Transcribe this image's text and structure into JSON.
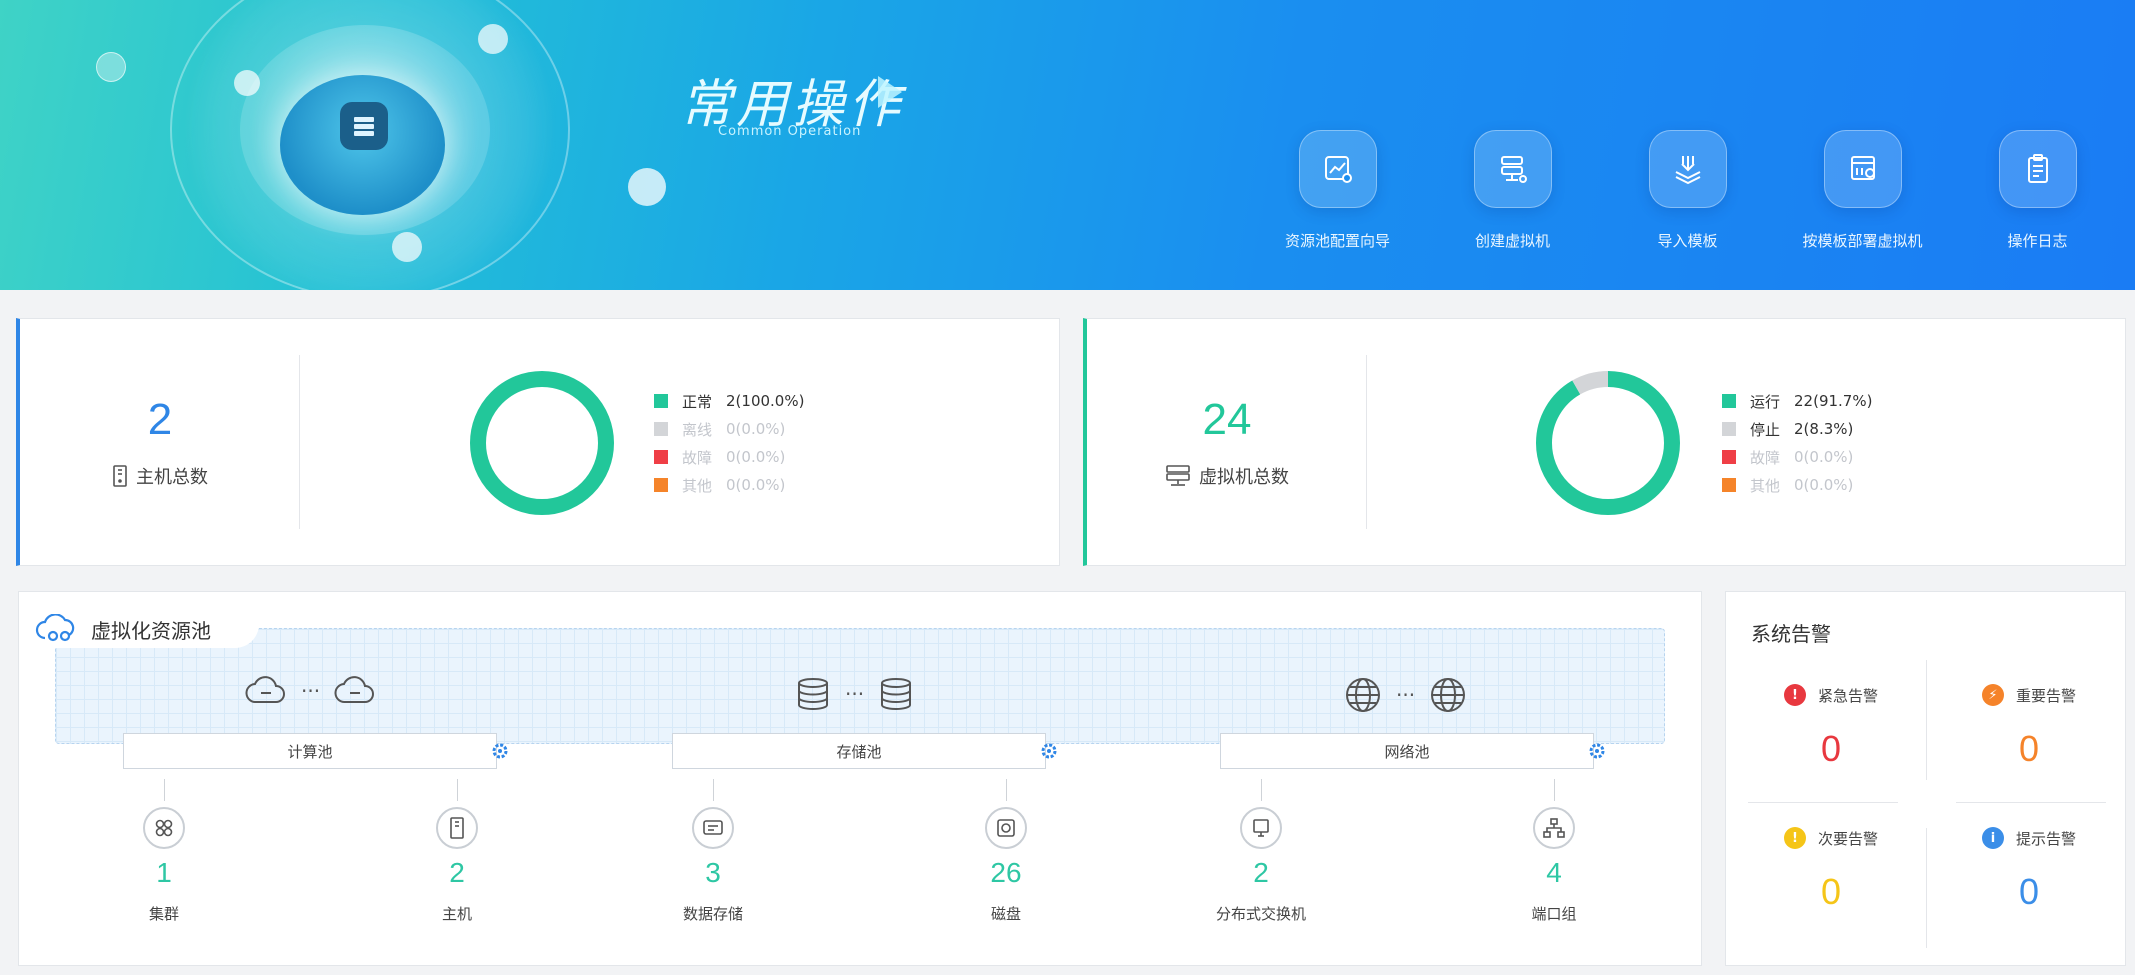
{
  "banner": {
    "title": "常用操作",
    "subtitle": "Common Operation",
    "operations": [
      {
        "label": "资源池配置向导",
        "icon": "chart-config-icon"
      },
      {
        "label": "创建虚拟机",
        "icon": "server-add-icon"
      },
      {
        "label": "导入模板",
        "icon": "import-icon"
      },
      {
        "label": "按模板部署虚拟机",
        "icon": "template-deploy-icon"
      },
      {
        "label": "操作日志",
        "icon": "clipboard-icon"
      }
    ]
  },
  "hosts": {
    "total": "2",
    "label": "主机总数",
    "legend": [
      {
        "name": "正常",
        "value": "2(100.0%)",
        "color": "#22c79a",
        "dim": false
      },
      {
        "name": "离线",
        "value": "0(0.0%)",
        "color": "#d3d5d8",
        "dim": true
      },
      {
        "name": "故障",
        "value": "0(0.0%)",
        "color": "#ef3e46",
        "dim": true
      },
      {
        "name": "其他",
        "value": "0(0.0%)",
        "color": "#f5842a",
        "dim": true
      }
    ],
    "slices": [
      100,
      0,
      0,
      0
    ]
  },
  "vms": {
    "total": "24",
    "label": "虚拟机总数",
    "legend": [
      {
        "name": "运行",
        "value": "22(91.7%)",
        "color": "#22c79a",
        "dim": false
      },
      {
        "name": "停止",
        "value": "2(8.3%)",
        "color": "#d3d5d8",
        "dim": false
      },
      {
        "name": "故障",
        "value": "0(0.0%)",
        "color": "#ef3e46",
        "dim": true
      },
      {
        "name": "其他",
        "value": "0(0.0%)",
        "color": "#f5842a",
        "dim": true
      }
    ],
    "slices": [
      91.7,
      8.3,
      0,
      0
    ]
  },
  "pool": {
    "title": "虚拟化资源池",
    "ellipsis": "···",
    "boxes": [
      {
        "label": "计算池",
        "icon": "cloud-icon"
      },
      {
        "label": "存储池",
        "icon": "database-icon"
      },
      {
        "label": "网络池",
        "icon": "globe-icon"
      }
    ],
    "resources": [
      {
        "value": "1",
        "label": "集群",
        "icon": "cluster-icon"
      },
      {
        "value": "2",
        "label": "主机",
        "icon": "host-icon"
      },
      {
        "value": "3",
        "label": "数据存储",
        "icon": "datastore-icon"
      },
      {
        "value": "26",
        "label": "磁盘",
        "icon": "disk-icon"
      },
      {
        "value": "2",
        "label": "分布式交换机",
        "icon": "switch-icon"
      },
      {
        "value": "4",
        "label": "端口组",
        "icon": "portgroup-icon"
      }
    ]
  },
  "alarm": {
    "title": "系统告警",
    "items": [
      {
        "label": "紧急告警",
        "value": "0",
        "color": "#e8383f",
        "symbol": "!"
      },
      {
        "label": "重要告警",
        "value": "0",
        "color": "#f5832a",
        "symbol": "⚡"
      },
      {
        "label": "次要告警",
        "value": "0",
        "color": "#f5c518",
        "symbol": "!"
      },
      {
        "label": "提示告警",
        "value": "0",
        "color": "#3b8ee8",
        "symbol": "i"
      }
    ]
  }
}
